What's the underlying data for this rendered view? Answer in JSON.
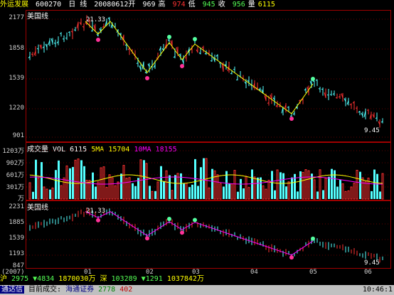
{
  "header": {
    "stock_name": "外运发展",
    "stock_code": "600270",
    "period": "日 线",
    "date_open_label": "20080612开",
    "open": "969",
    "high_label": "高",
    "low_value": "974",
    "low_label": "低",
    "close_value": "945",
    "close_label": "收",
    "volume_value": "956",
    "volume_label": "量",
    "volume_extra": "6115"
  },
  "price_panel": {
    "indicator_label": "美国线",
    "y_ticks": [
      "2177",
      "1858",
      "1539",
      "1220",
      "901"
    ],
    "peak_label": "21.33",
    "last_label": "9.45"
  },
  "volume_panel": {
    "title": "成交量",
    "vol_label": "VOL 6115",
    "sma_label": "5MA 15704",
    "ma10_label": "10MA 18155",
    "y_ticks": [
      "1203万",
      "902万",
      "601万",
      "301万",
      "万"
    ]
  },
  "lower_panel": {
    "indicator_label": "美国线",
    "y_ticks": [
      "2231",
      "1885",
      "1539",
      "1193",
      "847"
    ],
    "peak_label": "21.33",
    "last_label": "9.45"
  },
  "x_axis": {
    "left_label": "(2007)",
    "months": [
      "01",
      "02",
      "03",
      "04",
      "05",
      "06"
    ]
  },
  "status": {
    "sh_label": "沪",
    "sh_value": "2975",
    "sh_change": "▼4834",
    "sh_amount": "1870030万",
    "sz_label": "深",
    "sz_value": "103289",
    "sz_change": "▼1291",
    "sz_amount": "1037842万"
  },
  "footer": {
    "app_label": "通达信",
    "market_label": "目前成交:",
    "broker": "海通证券",
    "count1": "2778",
    "count2": "402",
    "clock": "10:46:1"
  },
  "colors": {
    "up": "#ff3232",
    "down": "#54ffff",
    "frame": "#a00000",
    "zigzag": "#ffff00",
    "ma5": "#ffff00",
    "ma10": "#ff00ff"
  }
}
